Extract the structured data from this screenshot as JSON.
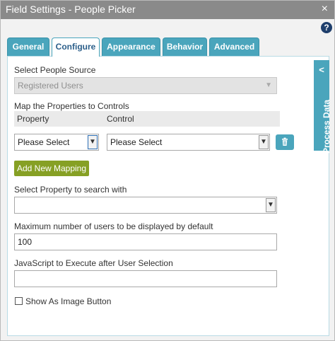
{
  "window": {
    "title": "Field Settings - People Picker",
    "close_glyph": "×"
  },
  "help": {
    "glyph": "?"
  },
  "tabs": [
    {
      "label": "General",
      "active": false
    },
    {
      "label": "Configure",
      "active": true
    },
    {
      "label": "Appearance",
      "active": false
    },
    {
      "label": "Behavior",
      "active": false
    },
    {
      "label": "Advanced",
      "active": false
    }
  ],
  "people_source": {
    "label": "Select People Source",
    "value": "Registered Users"
  },
  "mapping": {
    "label": "Map the Properties to Controls",
    "col_property": "Property",
    "col_control": "Control",
    "property_value": "Please Select",
    "control_value": "Please Select",
    "add_button": "Add New Mapping"
  },
  "search_property": {
    "label": "Select Property to search with",
    "value": ""
  },
  "max_users": {
    "label": "Maximum number of users to be displayed by default",
    "value": "100"
  },
  "javascript": {
    "label": "JavaScript to Execute after User Selection",
    "value": ""
  },
  "image_button": {
    "label": "Show As Image Button",
    "checked": false
  },
  "side_panel": {
    "label": "Process Data",
    "chevron": "<"
  },
  "colors": {
    "accent": "#4aa5bc",
    "title_bar": "#8a8a8a",
    "add_button": "#86a024"
  }
}
